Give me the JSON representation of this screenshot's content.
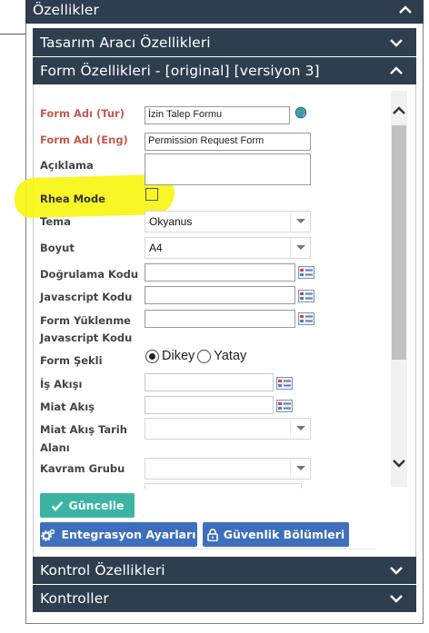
{
  "main_header": {
    "title": "Özellikler"
  },
  "sections": {
    "tasarim": "Tasarım Aracı Özellikleri",
    "form": "Form Özellikleri - [original] [versiyon 3]",
    "kontrol": "Kontrol Özellikleri",
    "kontroller": "Kontroller"
  },
  "fields": {
    "form_adi_tur": {
      "label": "Form Adı (Tur)",
      "value": "İzin Talep Formu"
    },
    "form_adi_eng": {
      "label": "Form Adı (Eng)",
      "value": "Permission Request Form"
    },
    "aciklama": {
      "label": "Açıklama",
      "value": ""
    },
    "rhea_mode": {
      "label": "Rhea Mode",
      "checked": false
    },
    "tema": {
      "label": "Tema",
      "value": "Okyanus"
    },
    "boyut": {
      "label": "Boyut",
      "value": "A4"
    },
    "dogrulama_kodu": {
      "label": "Doğrulama Kodu",
      "value": ""
    },
    "javascript_kodu": {
      "label": "Javascript Kodu",
      "value": ""
    },
    "form_yuklenme": {
      "label_line1": "Form Yüklenme",
      "label_line2": "Javascript Kodu",
      "value": ""
    },
    "form_sekli": {
      "label": "Form Şekli",
      "options": [
        "Dikey",
        "Yatay"
      ],
      "selected": "Dikey"
    },
    "is_akisi": {
      "label": "İş Akışı",
      "value": ""
    },
    "miat_akis": {
      "label": "Miat Akış",
      "value": ""
    },
    "miat_akis_tarih": {
      "label_line1": "Miat Akış Tarih",
      "label_line2": "Alanı",
      "value": ""
    },
    "kavram_grubu": {
      "label": "Kavram Grubu",
      "value": ""
    }
  },
  "buttons": {
    "guncelle": "Güncelle",
    "entegrasyon": "Entegrasyon Ayarları",
    "guvenlik": "Güvenlik Bölümleri"
  },
  "colors": {
    "header_bg": "#2e3e4e",
    "label_red": "#c8574f",
    "update_button": "#3cb4a3",
    "action_button": "#3e6fbd",
    "highlight": "#f8f518"
  },
  "icons": {
    "globe": "globe-icon",
    "picker": "list-picker-icon",
    "chevron_up": "chevron-up-icon",
    "chevron_down": "chevron-down-icon",
    "check": "check-icon",
    "gears": "gears-icon",
    "lock": "lock-icon"
  }
}
